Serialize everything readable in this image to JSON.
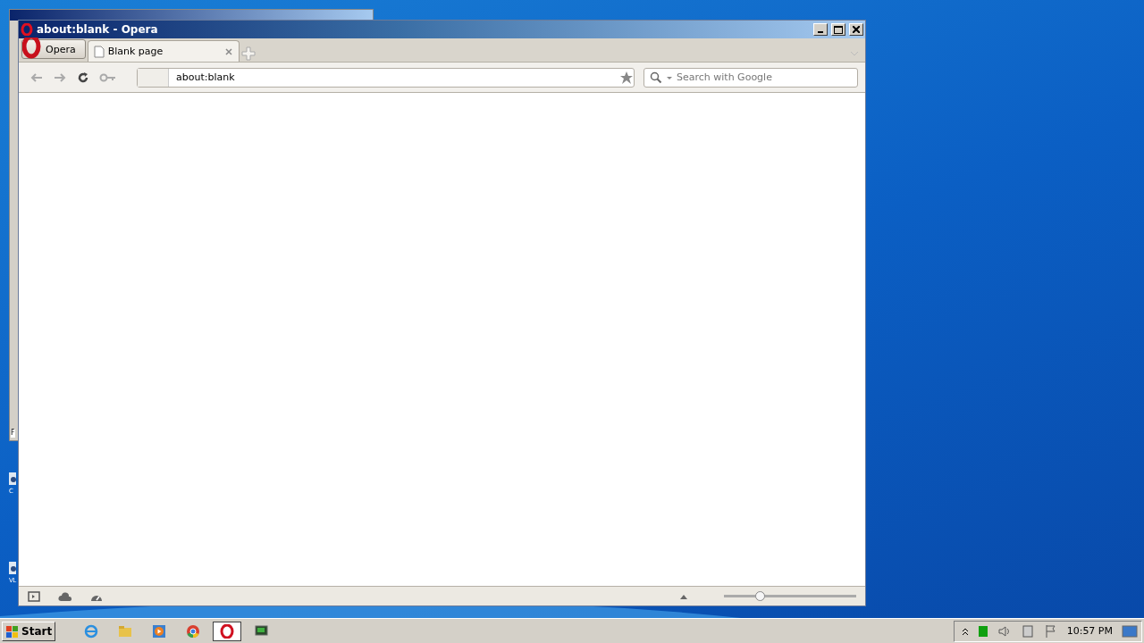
{
  "desktop": {
    "icons": [
      {
        "label": "C"
      },
      {
        "label": "VL"
      }
    ],
    "background_window": {
      "label": "F"
    }
  },
  "window": {
    "title": "about:blank - Opera"
  },
  "menu_button": {
    "label": "Opera"
  },
  "tabs": [
    {
      "label": "Blank page",
      "selected": true
    }
  ],
  "address_bar": {
    "value": "about:blank"
  },
  "search": {
    "placeholder": "Search with Google"
  },
  "zoom_slider": {
    "level": 0.28
  },
  "taskbar": {
    "start": "Start",
    "apps": [
      {
        "kind": "ie",
        "selected": false
      },
      {
        "kind": "folder",
        "selected": false
      },
      {
        "kind": "media",
        "selected": false
      },
      {
        "kind": "chrome",
        "selected": false
      },
      {
        "kind": "opera",
        "selected": true
      },
      {
        "kind": "monitor",
        "selected": false
      }
    ],
    "clock": "10:57 PM"
  }
}
